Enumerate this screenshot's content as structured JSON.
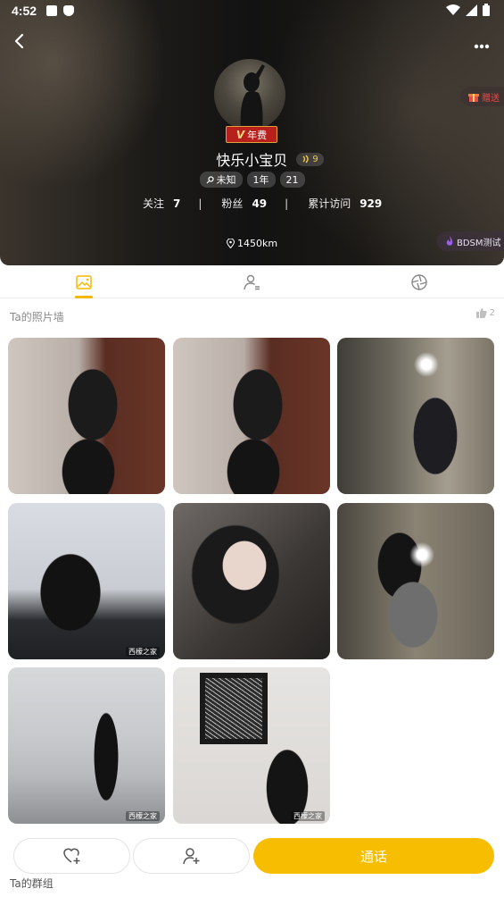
{
  "status": {
    "time": "4:52"
  },
  "profile": {
    "vip_label": "年费",
    "vip_mark": "V",
    "name": "快乐小宝贝",
    "level": "9",
    "tags": [
      "未知",
      "1年",
      "21"
    ],
    "stats": [
      {
        "label": "关注",
        "value": "7"
      },
      {
        "label": "粉丝",
        "value": "49"
      },
      {
        "label": "累计访问",
        "value": "929"
      }
    ],
    "location": "1450km"
  },
  "side_buttons": {
    "gift": "赠送",
    "test": "BDSM测试"
  },
  "photo_wall": {
    "title": "Ta的照片墙",
    "likes": "2",
    "watermark": "西檬之家"
  },
  "actions": {
    "call": "通话"
  },
  "group": {
    "title": "Ta的群组"
  },
  "colors": {
    "accent": "#f7bd00",
    "vip": "#b8201c"
  }
}
